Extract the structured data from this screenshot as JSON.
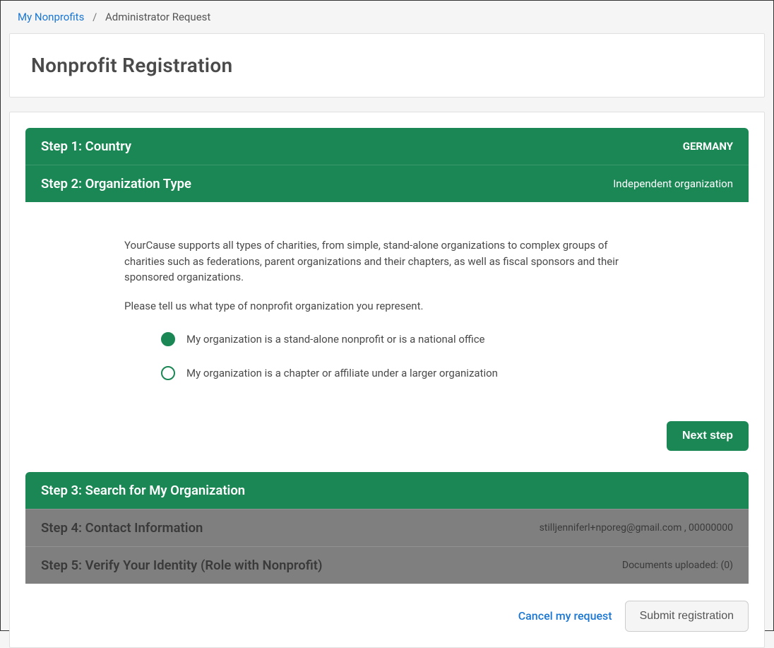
{
  "breadcrumb": {
    "link": "My Nonprofits",
    "current": "Administrator Request"
  },
  "page_title": "Nonprofit Registration",
  "steps": {
    "step1": {
      "title": "Step 1: Country",
      "value": "GERMANY"
    },
    "step2": {
      "title": "Step 2: Organization Type",
      "value": "Independent organization",
      "intro": "YourCause supports all types of charities, from simple, stand-alone organizations to complex groups of charities such as federations, parent organizations and their chapters, as well as fiscal sponsors and their sponsored organizations.",
      "prompt": "Please tell us what type of nonprofit organization you represent.",
      "options": [
        "My organization is a stand-alone nonprofit or is a national office",
        "My organization is a chapter or affiliate under a larger organization"
      ],
      "next_button": "Next step"
    },
    "step3": {
      "title": "Step 3: Search for My Organization"
    },
    "step4": {
      "title": "Step 4: Contact Information",
      "value": "stilljenniferl+nporeg@gmail.com , 00000000"
    },
    "step5": {
      "title": "Step 5: Verify Your Identity (Role with Nonprofit)",
      "value": "Documents uploaded: (0)"
    }
  },
  "footer": {
    "cancel": "Cancel my request",
    "submit": "Submit registration"
  }
}
